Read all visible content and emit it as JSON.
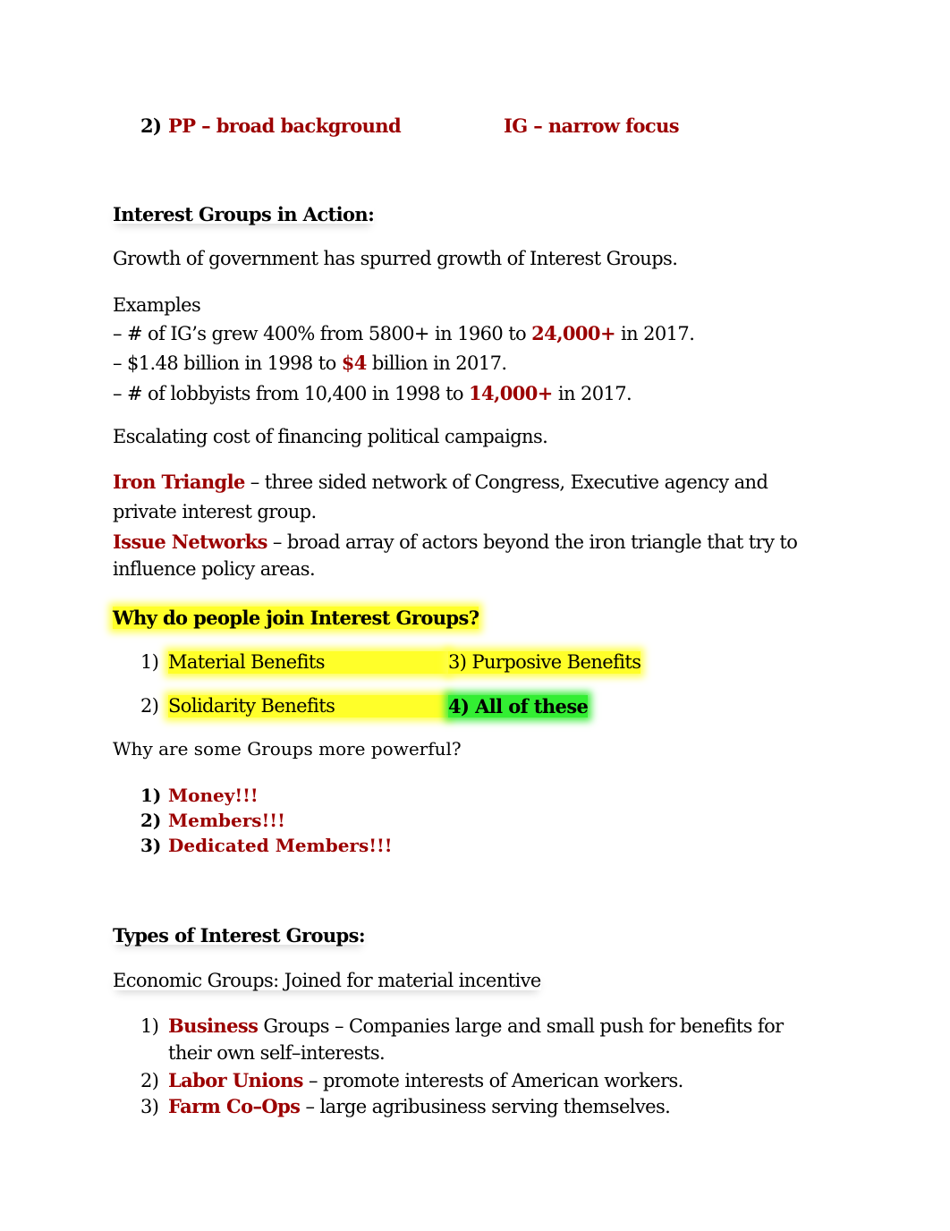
{
  "top_item": {
    "number": "2)",
    "left": "PP – broad background",
    "right": "IG – narrow focus"
  },
  "section_action": {
    "heading": "Interest Groups in Action:",
    "growth": "Growth of government has spurred growth of Interest Groups.",
    "examples_label": "Examples",
    "examples": [
      {
        "pre": "– # of IG’s grew 400% from 5800+ in 1960 to ",
        "hl": "24,000+",
        "post": " in 2017."
      },
      {
        "pre": "– $1.48 billion in 1998 to ",
        "hl": "$4",
        "post": " billion in 2017."
      },
      {
        "pre": "– # of lobbyists from 10,400 in 1998 to ",
        "hl": "14,000+",
        "post": " in 2017."
      }
    ],
    "escalating": "Escalating cost of financing political campaigns.",
    "iron_triangle": {
      "term": "Iron Triangle",
      "def_line1": " – three sided network of Congress, Executive agency and",
      "def_line2": "private interest group."
    },
    "issue_networks": {
      "term": "Issue Networks",
      "def_line1": " – broad array of actors beyond the iron triangle that try to",
      "def_line2": "influence policy areas."
    }
  },
  "section_join": {
    "heading": "Why do people join Interest Groups?",
    "options": [
      {
        "num": "1)",
        "label": "Material Benefits"
      },
      {
        "num": "3)",
        "label": "Purposive Benefits"
      },
      {
        "num": "2)",
        "label": "Solidarity Benefits"
      },
      {
        "num": "4)",
        "label": "All of these"
      }
    ]
  },
  "section_power": {
    "question": "Why are some Groups more powerful?",
    "items": [
      {
        "num": "1)",
        "label": "Money!!!"
      },
      {
        "num": "2)",
        "label": "Members!!!"
      },
      {
        "num": "3)",
        "label": "Dedicated Members!!!"
      }
    ]
  },
  "section_types": {
    "heading": "Types of Interest Groups:",
    "economic": "Economic Groups: Joined for material incentive",
    "items": [
      {
        "num": "1)",
        "term": "Business",
        "rest_line1": " Groups – Companies large and small push for benefits for",
        "rest_line2": "their own self–interests."
      },
      {
        "num": "2)",
        "term": "Labor Unions",
        "rest_line1": " – promote interests of American workers."
      },
      {
        "num": "3)",
        "term": "Farm Co–Ops",
        "rest_line1": " – large agribusiness serving themselves."
      }
    ]
  }
}
